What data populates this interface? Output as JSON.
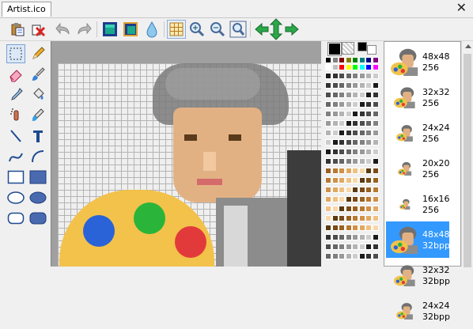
{
  "window": {
    "tab_title": "Artist.ico",
    "close_glyph": "✕"
  },
  "toolbar": {
    "icons": [
      "paste-icon",
      "delete-icon",
      "undo-icon",
      "redo-icon",
      "layer-front-icon",
      "layer-stack-icon",
      "drop-icon",
      "grid-icon",
      "zoom-in-icon",
      "zoom-out-icon",
      "zoom-fit-icon",
      "move-left-icon",
      "move-vertical-icon",
      "move-right-icon"
    ]
  },
  "tools": [
    "selection-rect-icon",
    "pencil-icon",
    "eraser-icon",
    "brush-icon",
    "eyedropper-icon",
    "fill-icon",
    "airbrush-icon",
    "color-replace-icon",
    "line-icon",
    "text-icon",
    "curve-icon",
    "arc-icon",
    "rectangle-outline-icon",
    "rectangle-filled-icon",
    "ellipse-outline-icon",
    "ellipse-filled-icon",
    "rounded-rect-outline-icon",
    "rounded-rect-filled-icon"
  ],
  "palette": {
    "primary": "#000000",
    "top_row": [
      "#000000",
      "#808080",
      "#800000",
      "#808000",
      "#008000",
      "#008080",
      "#000080",
      "#800080"
    ],
    "second_row": [
      "#ffffff",
      "#c0c0c0",
      "#ff0000",
      "#ffff00",
      "#00ff00",
      "#00ffff",
      "#0000ff",
      "#ff00ff"
    ]
  },
  "icon_entries": [
    {
      "size": "48x48",
      "depth": "256"
    },
    {
      "size": "32x32",
      "depth": "256"
    },
    {
      "size": "24x24",
      "depth": "256"
    },
    {
      "size": "20x20",
      "depth": "256"
    },
    {
      "size": "16x16",
      "depth": "256"
    },
    {
      "size": "48x48",
      "depth": "32bpp",
      "selected": true
    },
    {
      "size": "32x32",
      "depth": "32bpp"
    },
    {
      "size": "24x24",
      "depth": "32bpp"
    }
  ],
  "colors": {
    "selection": "#3399ff",
    "grid_line": "#b4b4b4",
    "canvas_bg": "#efefef"
  }
}
